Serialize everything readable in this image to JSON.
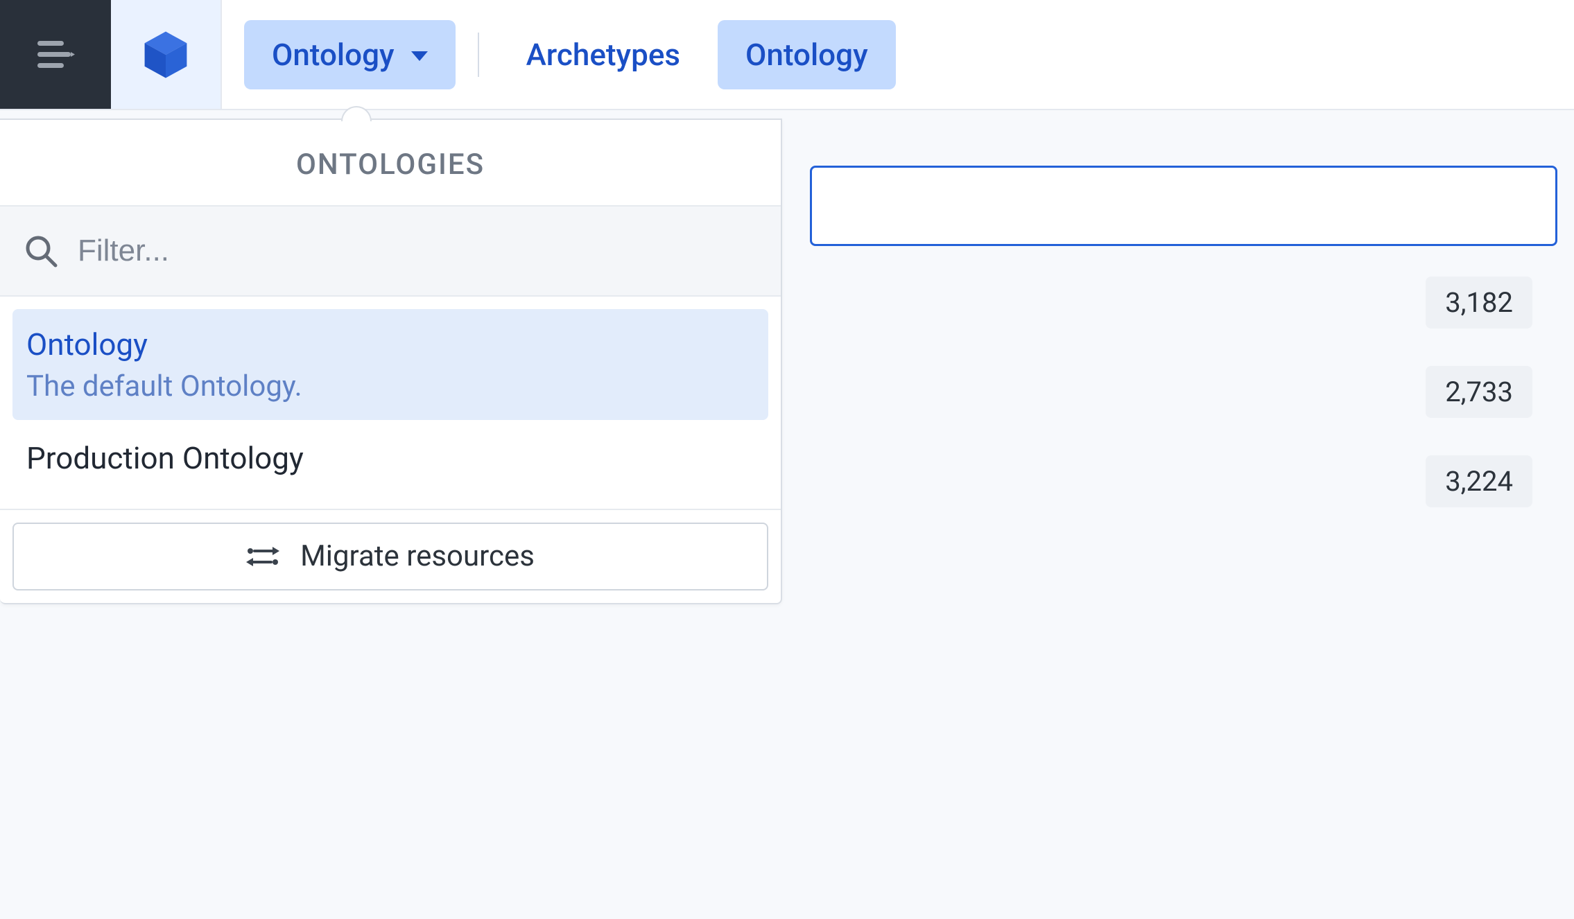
{
  "topbar": {
    "dropdown_label": "Ontology",
    "nav_archetypes": "Archetypes",
    "nav_ontology": "Ontology"
  },
  "popover": {
    "title": "ONTOLOGIES",
    "filter_placeholder": "Filter...",
    "items": [
      {
        "name": "Ontology",
        "desc": "The default Ontology.",
        "selected": true
      },
      {
        "name": "Production Ontology",
        "desc": "",
        "selected": false
      }
    ],
    "migrate_label": "Migrate resources"
  },
  "right": {
    "counts": [
      "3,182",
      "2,733",
      "3,224"
    ]
  },
  "colors": {
    "accent": "#1a4fc5",
    "chip_bg": "#c3dafe",
    "selected_bg": "#e2ecfb",
    "dark_bg": "#29303a"
  }
}
